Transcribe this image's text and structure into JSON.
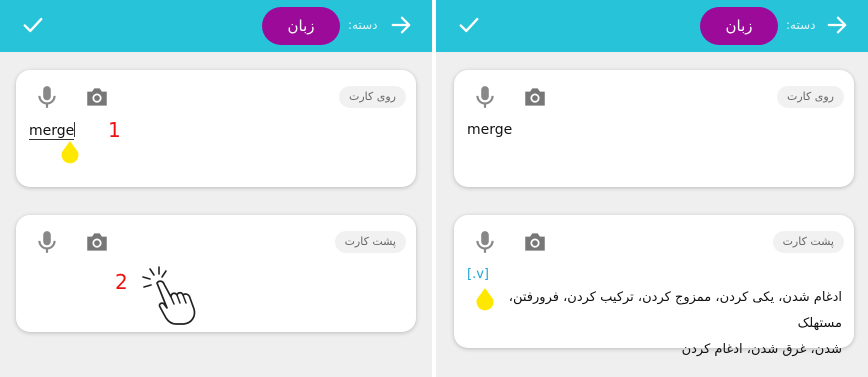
{
  "left_panel": {
    "header": {
      "category_label": "دسته:",
      "language_button": "زبان"
    },
    "front_card": {
      "label": "روی کارت",
      "value": "merge",
      "step_number": "1"
    },
    "back_card": {
      "label": "پشت کارت",
      "value": "",
      "step_number": "2"
    }
  },
  "right_panel": {
    "header": {
      "category_label": "دسته:",
      "language_button": "زبان"
    },
    "front_card": {
      "label": "روی کارت",
      "value": "merge"
    },
    "back_card": {
      "label": "پشت کارت",
      "part_of_speech": "[.v]",
      "meaning_line1": "ادغام شدن، یکی کردن، ممزوج کردن، ترکیب کردن، فرورفتن، مستهلک",
      "meaning_line2": "شدن، غرق شدن، ادغام کردن"
    }
  },
  "colors": {
    "header_bg": "#27c3d9",
    "accent_purple": "#9c0a9a",
    "panel_bg": "#efefef",
    "indicator_yellow": "#ffe800",
    "step_red": "#e11111"
  },
  "icons": [
    "check-icon",
    "arrow-right-icon",
    "mic-icon",
    "camera-icon",
    "tap-hand-icon",
    "touch-indicator-icon"
  ]
}
